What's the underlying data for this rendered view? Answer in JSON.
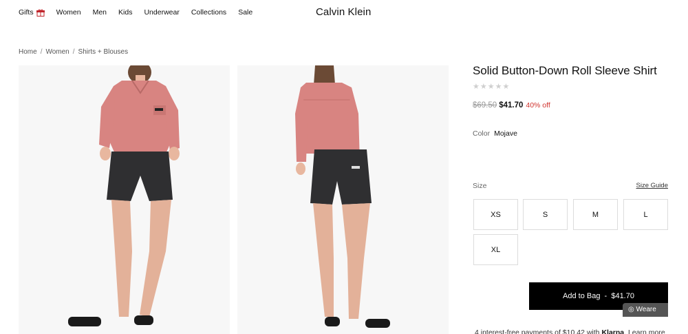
{
  "nav": {
    "items": [
      {
        "label": "Gifts",
        "icon": "gift-icon"
      },
      {
        "label": "Women"
      },
      {
        "label": "Men"
      },
      {
        "label": "Kids"
      },
      {
        "label": "Underwear"
      },
      {
        "label": "Collections"
      },
      {
        "label": "Sale"
      }
    ],
    "brand": "Calvin Klein"
  },
  "breadcrumb": [
    "Home",
    "Women",
    "Shirts + Blouses"
  ],
  "product": {
    "title": "Solid Button-Down Roll Sleeve Shirt",
    "rating_stars": 5,
    "rating_filled": 0,
    "original_price": "$69.50",
    "sale_price": "$41.70",
    "discount": "40% off",
    "color_label": "Color",
    "color_value": "Mojave",
    "size_label": "Size",
    "size_guide": "Size Guide",
    "sizes": [
      "XS",
      "S",
      "M",
      "L",
      "XL"
    ],
    "add_to_bag": "Add to Bag  -  $41.70",
    "chat_tab": "Weare",
    "klarna": {
      "prefix": "4 interest-free payments of $10.42 with",
      "brand": "Klarna",
      "link": "Learn more"
    }
  },
  "colors": {
    "accent_red": "#d0322d",
    "shirt": "#d88481",
    "shorts": "#2f2f31",
    "button_black": "#000000"
  }
}
